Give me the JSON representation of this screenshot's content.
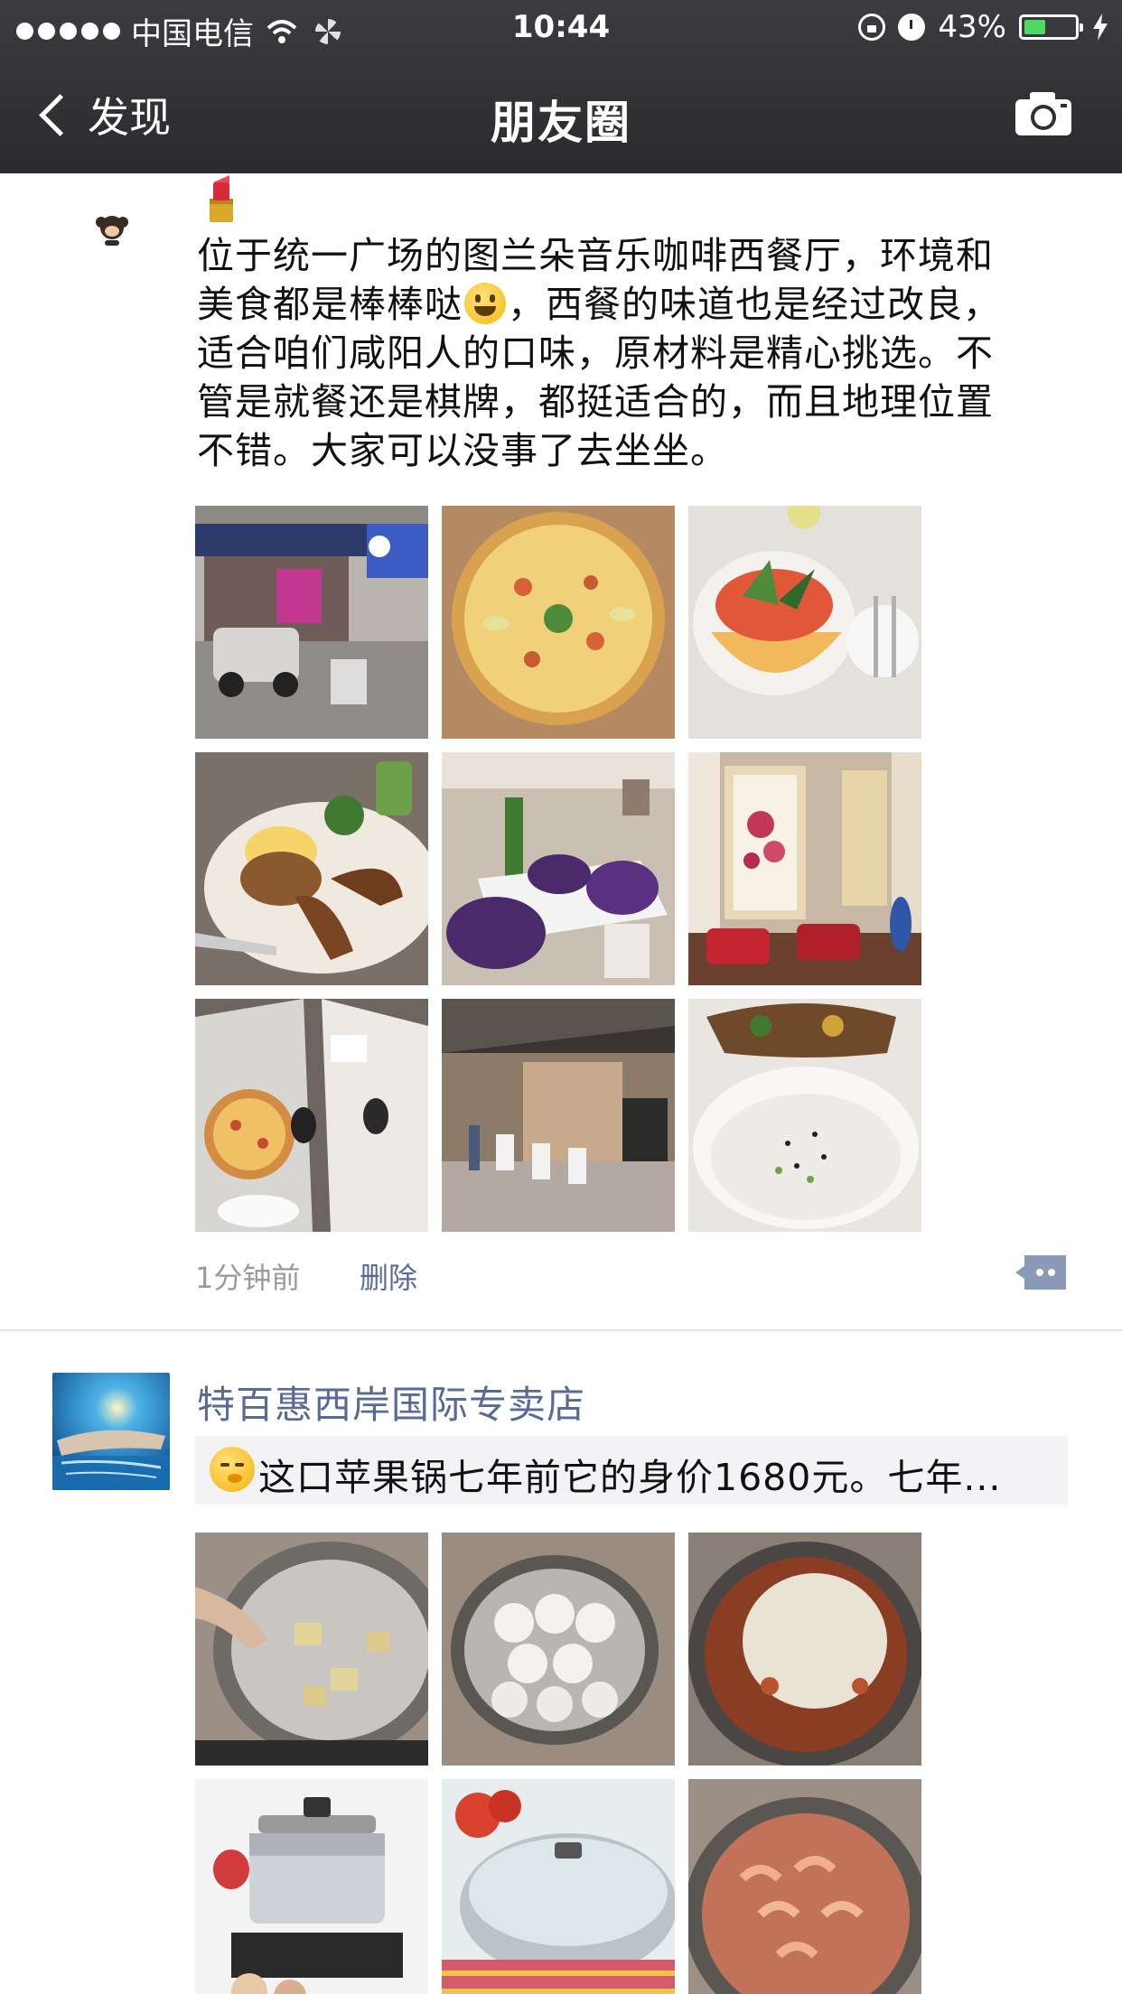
{
  "status_bar": {
    "carrier": "中国电信",
    "time": "10:44",
    "battery": "43%",
    "battery_level": 0.43
  },
  "nav": {
    "back_label": "发现",
    "title": "朋友圈"
  },
  "post1": {
    "text_part1": "位于统一广场的图兰朵音乐咖啡西餐厅，环境和美食都是棒棒哒",
    "text_part2": "，西餐的味道也是经过改良，适合咱们咸阳人的口味，原材料是精心挑选。不管是就餐还是棋牌，都挺适合的，而且地理位置不错。大家可以没事了去坐坐。",
    "photos": [
      "restaurant-storefront",
      "pizza",
      "fruit-salad",
      "fried-chicken-plate",
      "dining-room-purple",
      "chinese-painting-corner",
      "table-with-pizza",
      "dining-hall",
      "rice-bowl"
    ],
    "time_ago": "1分钟前",
    "delete_label": "删除"
  },
  "post2": {
    "author": "特百惠西岸国际专卖店",
    "share_text": "这口苹果锅七年前它的身价1680元。七年...",
    "photos": [
      "pan-cooking",
      "steamed-buns-pot",
      "pizza-in-pan",
      "steel-pot-stove",
      "glass-lid-pot",
      "shrimp-pot"
    ]
  },
  "colors": {
    "nav_bg": "#2b2b2e",
    "link": "#576b95",
    "meta_text": "#9a9a9a",
    "battery_green": "#4cd964"
  }
}
